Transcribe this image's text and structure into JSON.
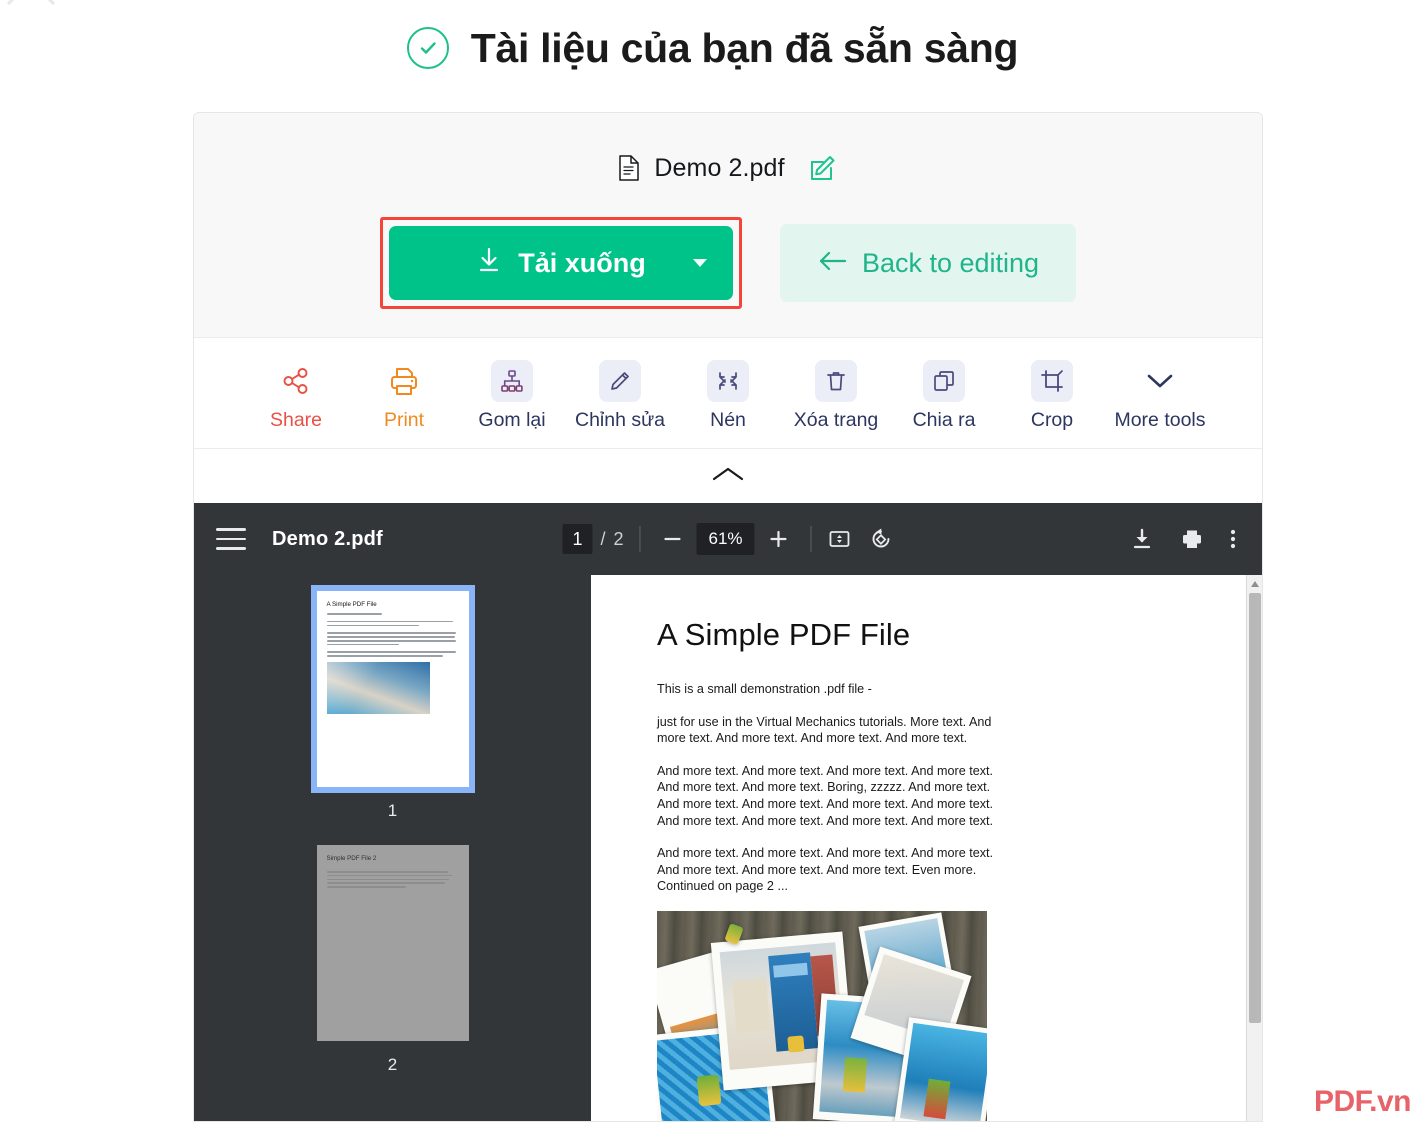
{
  "header": {
    "title": "Tài liệu của bạn đã sẵn sàng",
    "check_icon": "check-circle-icon",
    "accent_green": "#21c08b"
  },
  "card": {
    "file": {
      "name": "Demo 2.pdf",
      "doc_icon": "document-icon",
      "edit_icon": "edit-pencil-icon"
    },
    "actions": {
      "download_label": "Tải xuống",
      "download_icon": "download-arrow-icon",
      "download_caret": "chevron-down-icon",
      "download_color": "#00c389",
      "highlight_color": "#f4443c",
      "back_label": "Back to editing",
      "back_icon": "arrow-left-icon",
      "back_color": "#1fb589"
    },
    "tools": [
      {
        "label": "Share",
        "icon": "share-nodes-icon",
        "boxed": false,
        "color": "#e85144"
      },
      {
        "label": "Print",
        "icon": "printer-icon",
        "boxed": false,
        "color": "#f08a20"
      },
      {
        "label": "Gom lại",
        "icon": "merge-hierarchy-icon",
        "boxed": true,
        "color": "#2d3561"
      },
      {
        "label": "Chỉnh sửa",
        "icon": "pencil-icon",
        "boxed": true,
        "color": "#2d3561"
      },
      {
        "label": "Nén",
        "icon": "compress-icon",
        "boxed": true,
        "color": "#2d3561"
      },
      {
        "label": "Xóa trang",
        "icon": "trash-icon",
        "boxed": true,
        "color": "#2d3561"
      },
      {
        "label": "Chia ra",
        "icon": "split-copy-icon",
        "boxed": true,
        "color": "#2d3561"
      },
      {
        "label": "Crop",
        "icon": "crop-icon",
        "boxed": true,
        "color": "#2d3561"
      },
      {
        "label": "More tools",
        "icon": "chevron-down-icon",
        "boxed": false,
        "color": "#2d3561"
      }
    ],
    "collapse_icon": "chevron-up-icon"
  },
  "viewer": {
    "menu_icon": "hamburger-menu-icon",
    "filename": "Demo 2.pdf",
    "page_current": "1",
    "page_separator": "/",
    "page_total": "2",
    "zoom_out_icon": "minus-icon",
    "zoom_level": "61%",
    "zoom_in_icon": "plus-icon",
    "fit_page_icon": "fit-page-icon",
    "rotate_icon": "rotate-icon",
    "download_icon": "download-icon",
    "print_icon": "printer-icon",
    "more_icon": "more-vertical-icon",
    "thumbnails": [
      {
        "number": "1",
        "title": "A Simple PDF File",
        "selected": true,
        "loaded": true
      },
      {
        "number": "2",
        "title": "Simple PDF File 2",
        "selected": false,
        "loaded": false
      }
    ],
    "document": {
      "heading": "A Simple PDF File",
      "paragraphs": [
        "This is a small demonstration .pdf file -",
        "just for use in the Virtual Mechanics tutorials. More text. And more text. And more text. And more text. And more text.",
        "And more text. And more text. And more text. And more text. And more text. And more text. Boring, zzzzz. And more text. And more text. And more text. And more text. And more text. And more text. And more text. And more text. And more text.",
        "And more text. And more text. And more text. And more text. And more text. And more text. And more text. Even more. Continued on page 2 ..."
      ],
      "photo_alt": "photo-collage-polaroids"
    }
  },
  "watermark": {
    "text": "PDF.vn",
    "color": "#e8626a"
  }
}
